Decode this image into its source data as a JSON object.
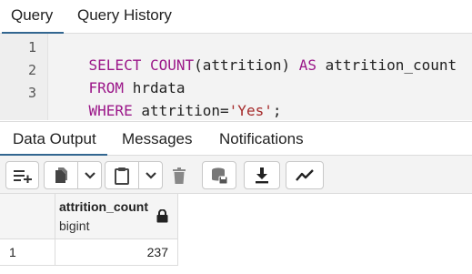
{
  "query_tabs": [
    {
      "label": "Query",
      "active": true
    },
    {
      "label": "Query History",
      "active": false
    }
  ],
  "editor": {
    "line_numbers": [
      "1",
      "2",
      "3"
    ],
    "lines": [
      [
        {
          "t": "SELECT",
          "c": "kw"
        },
        {
          "t": " "
        },
        {
          "t": "COUNT",
          "c": "kw"
        },
        {
          "t": "(attrition) "
        },
        {
          "t": "AS",
          "c": "kw"
        },
        {
          "t": " attrition_count"
        }
      ],
      [
        {
          "t": "FROM",
          "c": "kw"
        },
        {
          "t": " hrdata"
        }
      ],
      [
        {
          "t": "WHERE",
          "c": "kw"
        },
        {
          "t": " attrition="
        },
        {
          "t": "'Yes'",
          "c": "str"
        },
        {
          "t": ";"
        }
      ]
    ]
  },
  "output_tabs": [
    {
      "label": "Data Output",
      "active": true
    },
    {
      "label": "Messages",
      "active": false
    },
    {
      "label": "Notifications",
      "active": false
    }
  ],
  "toolbar": {
    "buttons": [
      "add-row-icon",
      "copy-icon",
      "dropdown-icon",
      "paste-icon",
      "dropdown-icon",
      "delete-icon",
      "save-data-icon",
      "download-icon",
      "graph-icon"
    ]
  },
  "grid": {
    "columns": [
      {
        "name": "attrition_count",
        "type": "bigint",
        "locked": true
      }
    ],
    "rows": [
      {
        "num": "1",
        "cells": [
          "237"
        ]
      }
    ]
  },
  "colors": {
    "accent": "#326690",
    "keyword": "#9b1789",
    "string": "#a52a2a"
  }
}
